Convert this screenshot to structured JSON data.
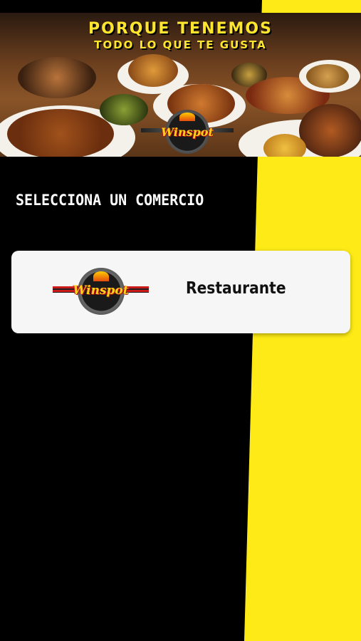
{
  "banner": {
    "line1": "PORQUE TENEMOS",
    "line2": "TODO LO QUE TE GUSTA",
    "logo_text": "Winspot"
  },
  "section": {
    "title": "SELECCIONA UN COMERCIO"
  },
  "merchants": [
    {
      "logo_text": "Winspot",
      "label": "Restaurante"
    }
  ],
  "colors": {
    "accent_yellow": "#fdea16",
    "background": "#000000",
    "card": "#f6f6f6"
  }
}
